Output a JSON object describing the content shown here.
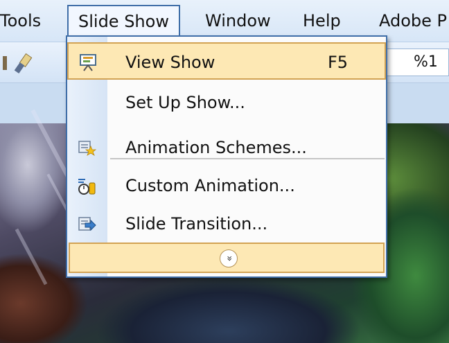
{
  "menubar": {
    "items": [
      {
        "label": "Tools"
      },
      {
        "label": "Slide Show"
      },
      {
        "label": "Window"
      },
      {
        "label": "Help"
      },
      {
        "label": "Adobe P"
      }
    ]
  },
  "toolbar": {
    "zoom_value": "%1"
  },
  "dropdown": {
    "items": [
      {
        "label": "View Show",
        "shortcut": "F5",
        "icon": "view-show-icon"
      },
      {
        "label": "Set Up Show...",
        "icon": ""
      },
      {
        "label": "Animation Schemes...",
        "icon": "animation-schemes-icon"
      },
      {
        "label": "Custom Animation...",
        "icon": "custom-animation-icon"
      },
      {
        "label": "Slide Transition...",
        "icon": "slide-transition-icon"
      }
    ],
    "expand_glyph": "»"
  },
  "colors": {
    "menu_border": "#3f6ea8",
    "highlight_fill": "#fde8b4",
    "highlight_border": "#d2a253"
  }
}
